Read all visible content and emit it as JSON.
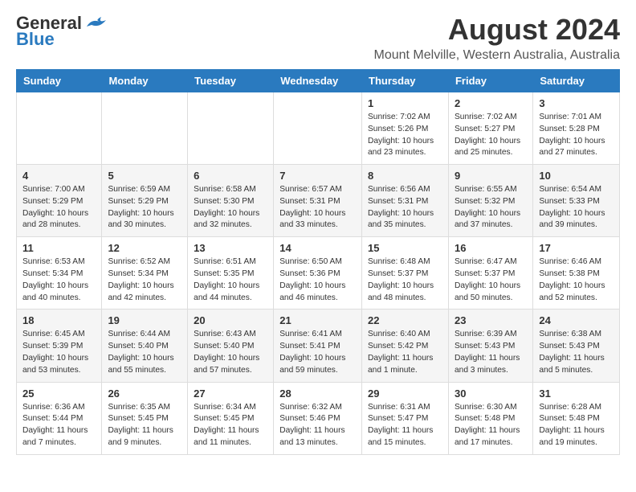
{
  "logo": {
    "line1": "General",
    "line2": "Blue"
  },
  "title": "August 2024",
  "subtitle": "Mount Melville, Western Australia, Australia",
  "days_header": [
    "Sunday",
    "Monday",
    "Tuesday",
    "Wednesday",
    "Thursday",
    "Friday",
    "Saturday"
  ],
  "weeks": [
    [
      {
        "day": "",
        "info": ""
      },
      {
        "day": "",
        "info": ""
      },
      {
        "day": "",
        "info": ""
      },
      {
        "day": "",
        "info": ""
      },
      {
        "day": "1",
        "info": "Sunrise: 7:02 AM\nSunset: 5:26 PM\nDaylight: 10 hours and 23 minutes."
      },
      {
        "day": "2",
        "info": "Sunrise: 7:02 AM\nSunset: 5:27 PM\nDaylight: 10 hours and 25 minutes."
      },
      {
        "day": "3",
        "info": "Sunrise: 7:01 AM\nSunset: 5:28 PM\nDaylight: 10 hours and 27 minutes."
      }
    ],
    [
      {
        "day": "4",
        "info": "Sunrise: 7:00 AM\nSunset: 5:29 PM\nDaylight: 10 hours and 28 minutes."
      },
      {
        "day": "5",
        "info": "Sunrise: 6:59 AM\nSunset: 5:29 PM\nDaylight: 10 hours and 30 minutes."
      },
      {
        "day": "6",
        "info": "Sunrise: 6:58 AM\nSunset: 5:30 PM\nDaylight: 10 hours and 32 minutes."
      },
      {
        "day": "7",
        "info": "Sunrise: 6:57 AM\nSunset: 5:31 PM\nDaylight: 10 hours and 33 minutes."
      },
      {
        "day": "8",
        "info": "Sunrise: 6:56 AM\nSunset: 5:31 PM\nDaylight: 10 hours and 35 minutes."
      },
      {
        "day": "9",
        "info": "Sunrise: 6:55 AM\nSunset: 5:32 PM\nDaylight: 10 hours and 37 minutes."
      },
      {
        "day": "10",
        "info": "Sunrise: 6:54 AM\nSunset: 5:33 PM\nDaylight: 10 hours and 39 minutes."
      }
    ],
    [
      {
        "day": "11",
        "info": "Sunrise: 6:53 AM\nSunset: 5:34 PM\nDaylight: 10 hours and 40 minutes."
      },
      {
        "day": "12",
        "info": "Sunrise: 6:52 AM\nSunset: 5:34 PM\nDaylight: 10 hours and 42 minutes."
      },
      {
        "day": "13",
        "info": "Sunrise: 6:51 AM\nSunset: 5:35 PM\nDaylight: 10 hours and 44 minutes."
      },
      {
        "day": "14",
        "info": "Sunrise: 6:50 AM\nSunset: 5:36 PM\nDaylight: 10 hours and 46 minutes."
      },
      {
        "day": "15",
        "info": "Sunrise: 6:48 AM\nSunset: 5:37 PM\nDaylight: 10 hours and 48 minutes."
      },
      {
        "day": "16",
        "info": "Sunrise: 6:47 AM\nSunset: 5:37 PM\nDaylight: 10 hours and 50 minutes."
      },
      {
        "day": "17",
        "info": "Sunrise: 6:46 AM\nSunset: 5:38 PM\nDaylight: 10 hours and 52 minutes."
      }
    ],
    [
      {
        "day": "18",
        "info": "Sunrise: 6:45 AM\nSunset: 5:39 PM\nDaylight: 10 hours and 53 minutes."
      },
      {
        "day": "19",
        "info": "Sunrise: 6:44 AM\nSunset: 5:40 PM\nDaylight: 10 hours and 55 minutes."
      },
      {
        "day": "20",
        "info": "Sunrise: 6:43 AM\nSunset: 5:40 PM\nDaylight: 10 hours and 57 minutes."
      },
      {
        "day": "21",
        "info": "Sunrise: 6:41 AM\nSunset: 5:41 PM\nDaylight: 10 hours and 59 minutes."
      },
      {
        "day": "22",
        "info": "Sunrise: 6:40 AM\nSunset: 5:42 PM\nDaylight: 11 hours and 1 minute."
      },
      {
        "day": "23",
        "info": "Sunrise: 6:39 AM\nSunset: 5:43 PM\nDaylight: 11 hours and 3 minutes."
      },
      {
        "day": "24",
        "info": "Sunrise: 6:38 AM\nSunset: 5:43 PM\nDaylight: 11 hours and 5 minutes."
      }
    ],
    [
      {
        "day": "25",
        "info": "Sunrise: 6:36 AM\nSunset: 5:44 PM\nDaylight: 11 hours and 7 minutes."
      },
      {
        "day": "26",
        "info": "Sunrise: 6:35 AM\nSunset: 5:45 PM\nDaylight: 11 hours and 9 minutes."
      },
      {
        "day": "27",
        "info": "Sunrise: 6:34 AM\nSunset: 5:45 PM\nDaylight: 11 hours and 11 minutes."
      },
      {
        "day": "28",
        "info": "Sunrise: 6:32 AM\nSunset: 5:46 PM\nDaylight: 11 hours and 13 minutes."
      },
      {
        "day": "29",
        "info": "Sunrise: 6:31 AM\nSunset: 5:47 PM\nDaylight: 11 hours and 15 minutes."
      },
      {
        "day": "30",
        "info": "Sunrise: 6:30 AM\nSunset: 5:48 PM\nDaylight: 11 hours and 17 minutes."
      },
      {
        "day": "31",
        "info": "Sunrise: 6:28 AM\nSunset: 5:48 PM\nDaylight: 11 hours and 19 minutes."
      }
    ]
  ]
}
